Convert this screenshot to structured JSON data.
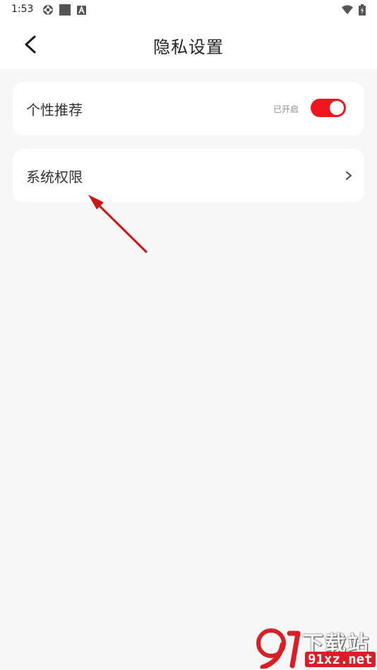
{
  "status_bar": {
    "time": "1:53",
    "icons": [
      "aperture-icon",
      "square-icon",
      "a-badge-icon",
      "wifi-icon",
      "battery-icon"
    ]
  },
  "header": {
    "title": "隐私设置",
    "back_icon": "chevron-left-icon"
  },
  "settings": [
    {
      "label": "个性推荐",
      "status_text": "已开启",
      "toggle_on": true,
      "accent_color": "#f0141e"
    },
    {
      "label": "系统权限",
      "icon": "chevron-right-icon"
    }
  ],
  "watermark": {
    "title": "下载站",
    "domain": "91xz.net"
  },
  "colors": {
    "background": "#f7f7f7",
    "card": "#ffffff",
    "accent": "#f0141e",
    "annotation": "#d11a1a"
  }
}
